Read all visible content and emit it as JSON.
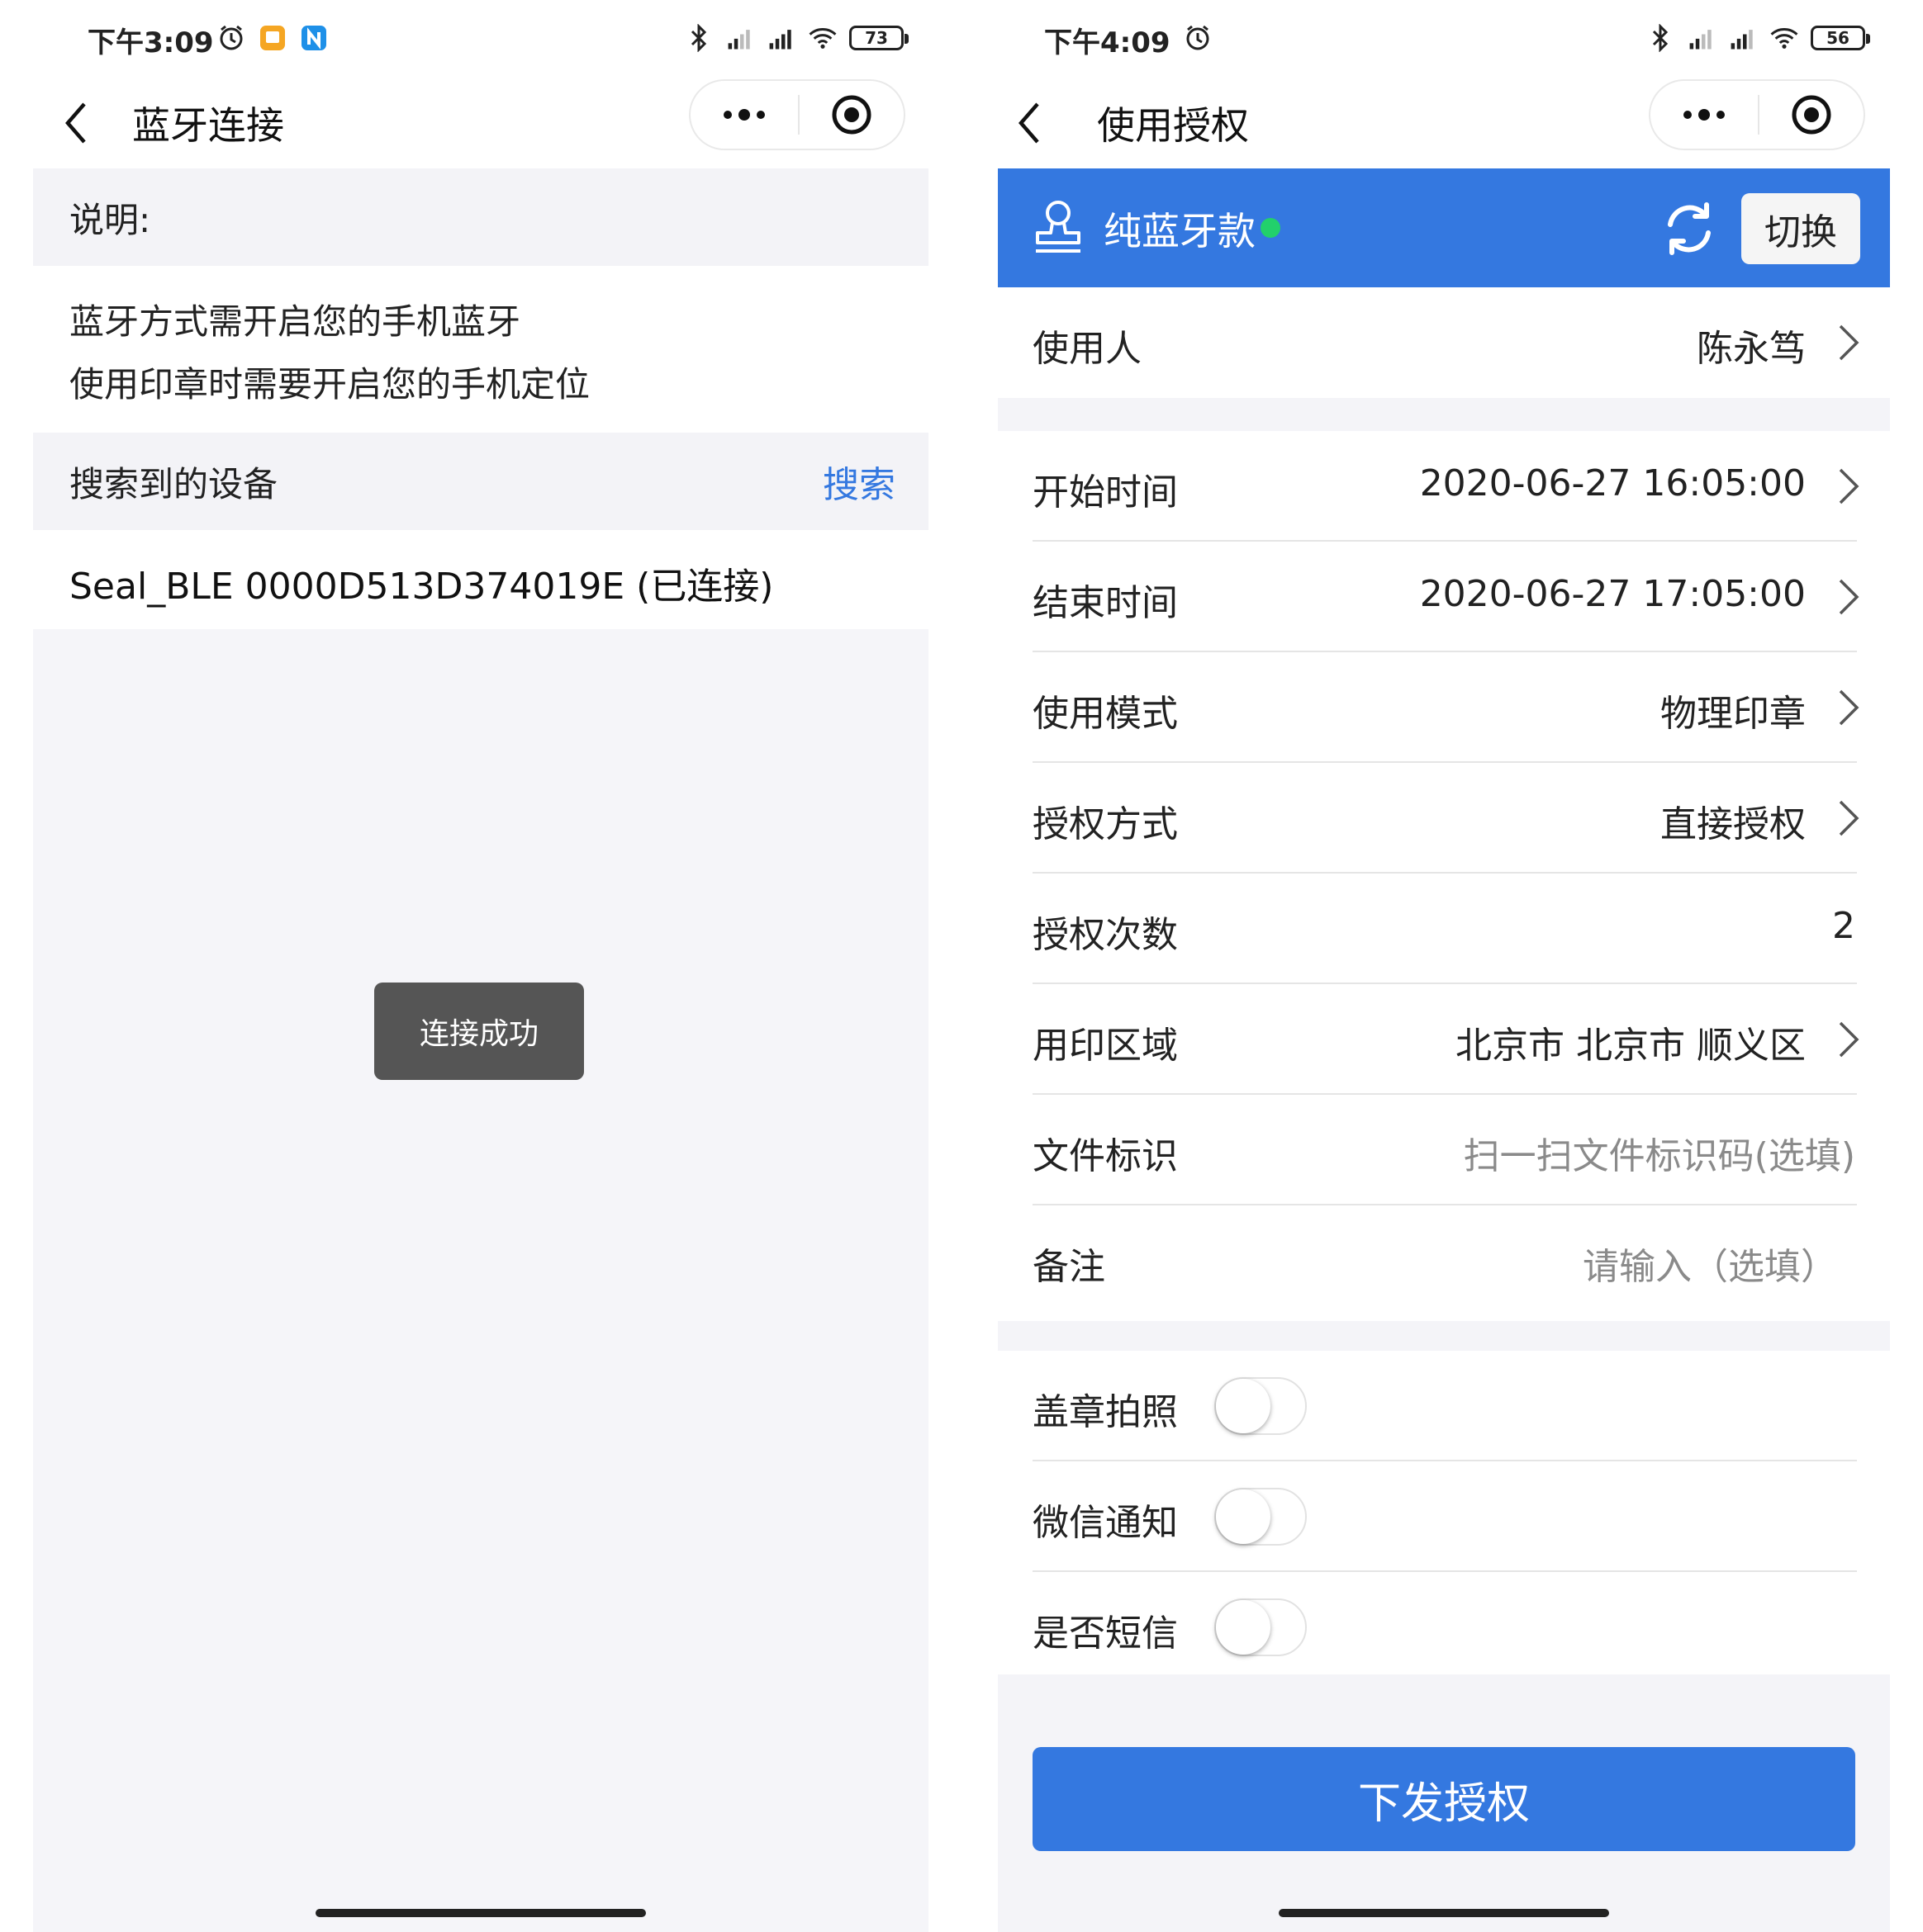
{
  "left": {
    "status": {
      "time": "下午3:09",
      "battery": "73"
    },
    "nav": {
      "title": "蓝牙连接"
    },
    "description": {
      "heading": "说明:",
      "lines": [
        "蓝牙方式需开启您的手机蓝牙",
        "使用印章时需要开启您的手机定位"
      ]
    },
    "devices": {
      "heading": "搜索到的设备",
      "search_label": "搜索",
      "items": [
        "Seal_BLE 0000D513D374019E (已连接)"
      ]
    },
    "toast": "连接成功"
  },
  "right": {
    "status": {
      "time": "下午4:09",
      "battery": "56"
    },
    "nav": {
      "title": "使用授权"
    },
    "banner": {
      "title": "纯蓝牙款",
      "switch_label": "切换",
      "status_color": "#22d06b"
    },
    "user_row": {
      "label": "使用人",
      "value": "陈永笃"
    },
    "rows": [
      {
        "label": "开始时间",
        "value": "2020-06-27 16:05:00"
      },
      {
        "label": "结束时间",
        "value": "2020-06-27 17:05:00"
      },
      {
        "label": "使用模式",
        "value": "物理印章"
      },
      {
        "label": "授权方式",
        "value": "直接授权"
      },
      {
        "label": "授权次数",
        "value": "2"
      },
      {
        "label": "用印区域",
        "value": "北京市 北京市 顺义区"
      },
      {
        "label": "文件标识",
        "value": "扫一扫文件标识码(选填)"
      },
      {
        "label": "备注",
        "value": "请输入（选填）"
      }
    ],
    "toggles": [
      {
        "label": "盖章拍照",
        "on": false
      },
      {
        "label": "微信通知",
        "on": false
      },
      {
        "label": "是否短信",
        "on": false
      }
    ],
    "submit_label": "下发授权"
  },
  "colors": {
    "accent": "#3478e0",
    "toast_bg": "#555555",
    "page_bg": "#f4f4f8"
  }
}
